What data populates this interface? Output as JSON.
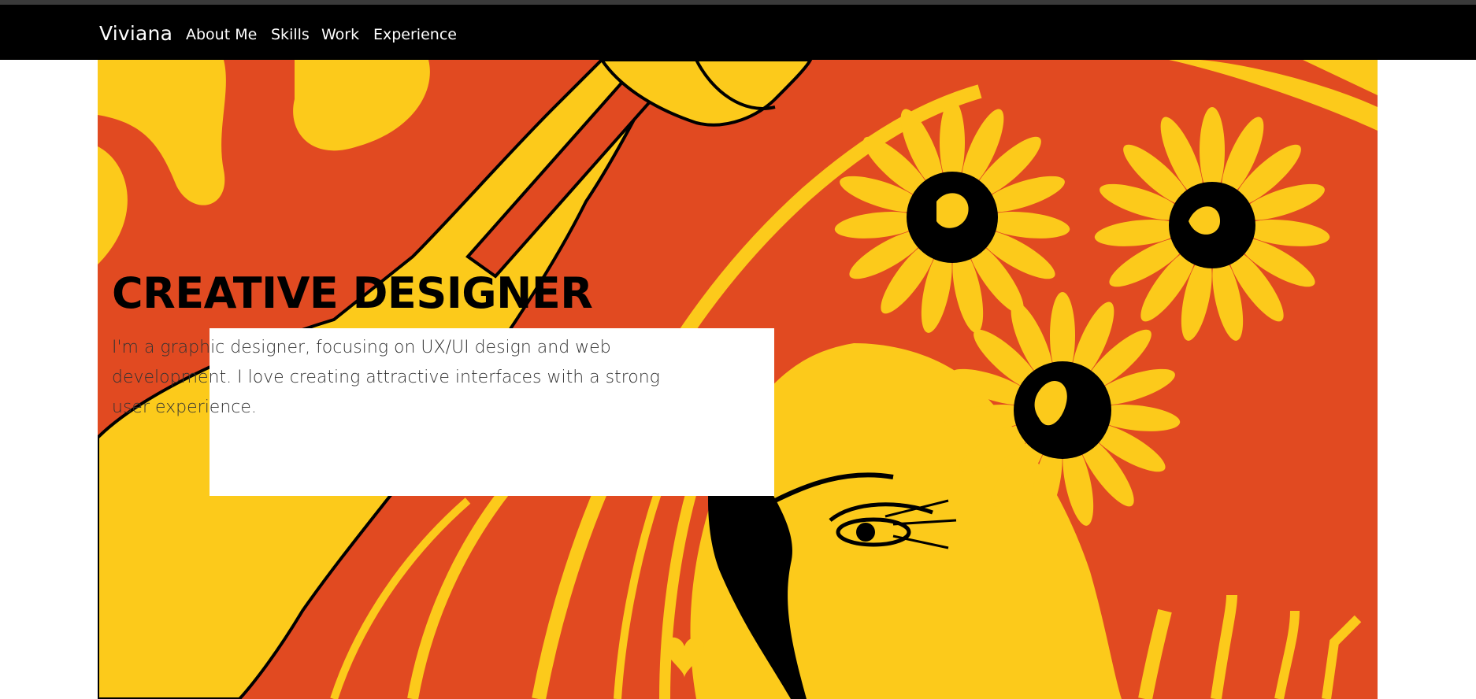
{
  "navbar": {
    "brand": "Viviana",
    "links": [
      "About Me",
      "Skills",
      "Work",
      "Experience"
    ]
  },
  "hero": {
    "title": "CREATIVE DESIGNER",
    "description": "I'm a graphic designer, focusing on UX/UI design and web development. I love creating attractive interfaces with a strong user experience.",
    "illustration": "orange-yellow-daisy-skull-face-illustration"
  },
  "colors": {
    "navbar": "#000000",
    "hero_orange": "#e14a21",
    "hero_yellow": "#fcca1b",
    "ink": "#000000"
  }
}
